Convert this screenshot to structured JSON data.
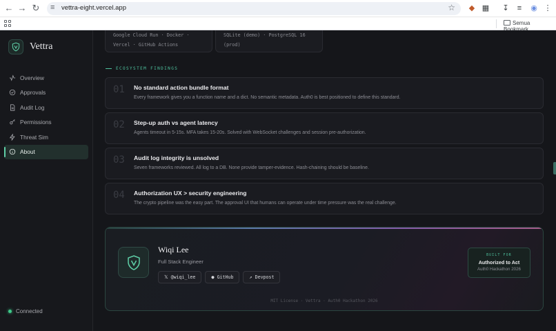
{
  "browser": {
    "url": "vettra-eight.vercel.app",
    "bookmark_folder": "Semua Bookmark"
  },
  "sidebar": {
    "brand": "Vettra",
    "items": [
      {
        "label": "Overview",
        "icon": "activity-icon"
      },
      {
        "label": "Approvals",
        "icon": "check-circle-icon"
      },
      {
        "label": "Audit Log",
        "icon": "document-icon"
      },
      {
        "label": "Permissions",
        "icon": "key-icon"
      },
      {
        "label": "Threat Sim",
        "icon": "zap-icon"
      },
      {
        "label": "About",
        "icon": "info-icon",
        "active": true
      }
    ],
    "status": "Connected"
  },
  "stack": {
    "left_lines": [
      "Google Cloud Run · Docker ·",
      "Vercel · GitHub Actions"
    ],
    "right_lines": [
      "SQLite (demo) · PostgreSQL 16",
      "(prod)"
    ]
  },
  "findings": {
    "label": "ECOSYSTEM FINDINGS",
    "items": [
      {
        "num": "01",
        "title": "No standard action bundle format",
        "desc": "Every framework gives you a function name and a dict. No semantic metadata. Auth0 is best positioned to define this standard."
      },
      {
        "num": "02",
        "title": "Step-up auth vs agent latency",
        "desc": "Agents timeout in 5-15s. MFA takes 15-20s. Solved with WebSocket challenges and session pre-authorization."
      },
      {
        "num": "03",
        "title": "Audit log integrity is unsolved",
        "desc": "Seven frameworks reviewed. All log to a DB. None provide tamper-evidence. Hash-chaining should be baseline."
      },
      {
        "num": "04",
        "title": "Authorization UX > security engineering",
        "desc": "The crypto pipeline was the easy part. The approval UI that humans can operate under time pressure was the real challenge."
      }
    ]
  },
  "profile": {
    "name": "Wiqi Lee",
    "role": "Full Stack Engineer",
    "links": [
      {
        "label": "@wiqi_lee",
        "icon": "x-icon"
      },
      {
        "label": "GitHub",
        "icon": "github-icon"
      },
      {
        "label": "Devpost",
        "icon": "external-link-icon"
      }
    ],
    "built_for_label": "BUILT FOR",
    "built_for_title": "Authorized to Act",
    "built_for_sub": "Auth0 Hackathon 2026",
    "footer": "MIT License · Vettra · Auth0 Hackathon 2026"
  },
  "colors": {
    "accent": "#4fc39f",
    "background": "#15161a",
    "card": "#1a1b20"
  }
}
